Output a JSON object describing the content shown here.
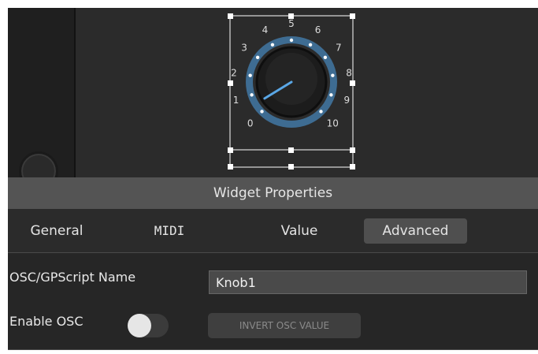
{
  "colors": {
    "background": "#262626",
    "header": "#545454",
    "active_tab": "#4f4f4f",
    "knob_ring": "#3e6c92",
    "knob_pointer": "#5aa7e6",
    "selection": "#ffffff"
  },
  "canvas": {
    "knob": {
      "widget_name": "Knob1",
      "value_fraction": 0.05,
      "scale_labels": [
        "0",
        "1",
        "2",
        "3",
        "4",
        "5",
        "6",
        "7",
        "8",
        "9",
        "10"
      ]
    }
  },
  "properties": {
    "title": "Widget Properties",
    "tabs": [
      {
        "label": "General",
        "active": false
      },
      {
        "label": "MIDI",
        "active": false
      },
      {
        "label": "Value",
        "active": false
      },
      {
        "label": "Advanced",
        "active": true
      }
    ],
    "advanced": {
      "osc_name_label": "OSC/GPScript Name",
      "osc_name_value": "Knob1",
      "enable_osc_label": "Enable OSC",
      "enable_osc_on": false,
      "invert_button_label": "INVERT OSC VALUE"
    }
  }
}
